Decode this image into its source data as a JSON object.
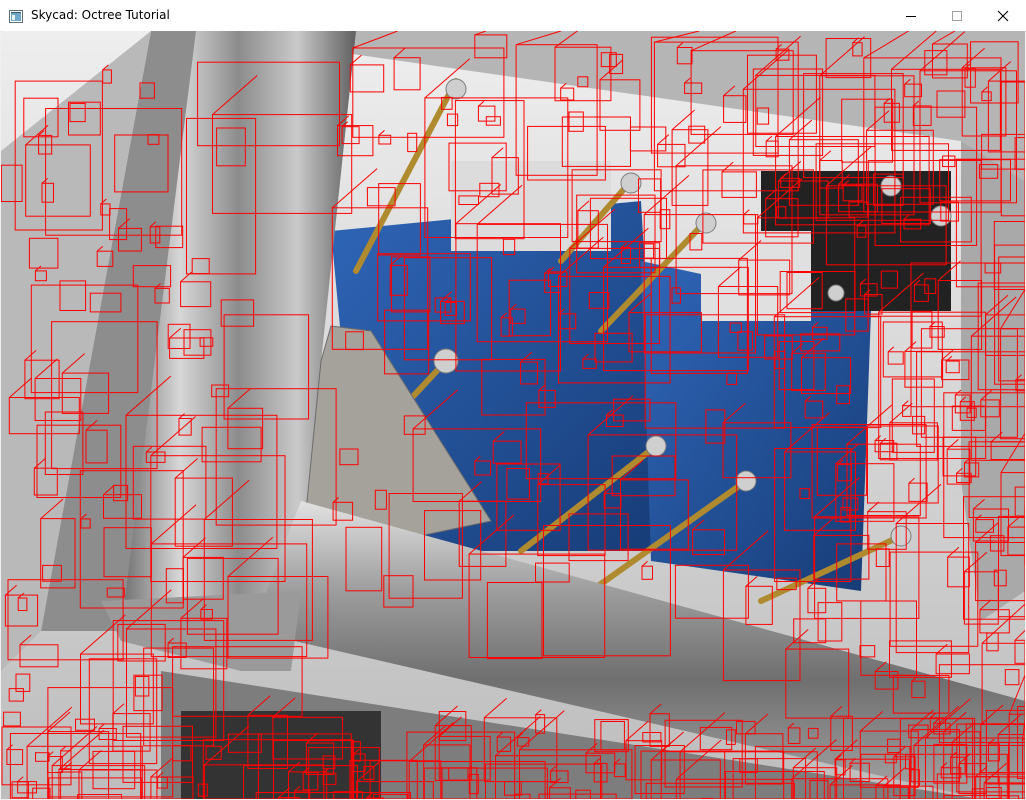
{
  "window": {
    "title": "Skycad: Octree Tutorial",
    "icons": {
      "app": "application-icon",
      "minimize": "minimize-icon",
      "maximize": "maximize-icon",
      "close": "close-icon"
    }
  },
  "scene": {
    "description_icon": "3d-render-viewport",
    "colors": {
      "octree_lines": "#ff0000",
      "frame_metal": "#9a9a9a",
      "pcb": "#1e4f9a",
      "background_top": "#eeeeee",
      "background_bottom": "#bdbdbd"
    }
  }
}
